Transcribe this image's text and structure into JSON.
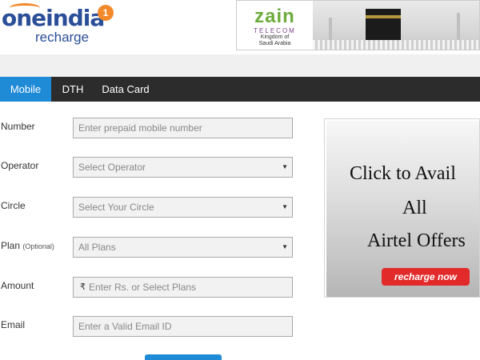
{
  "header": {
    "logo_main": "oneindia",
    "logo_sub": "recharge",
    "logo_badge": "1"
  },
  "banner": {
    "brand": "zain",
    "tagline": "TELECOM",
    "country_line1": "Kingdom of",
    "country_line2": "Saudi Arabia"
  },
  "tabs": [
    {
      "label": "Mobile",
      "active": true
    },
    {
      "label": "DTH",
      "active": false
    },
    {
      "label": "Data Card",
      "active": false
    }
  ],
  "form": {
    "number": {
      "label": "Number",
      "placeholder": "Enter prepaid mobile number"
    },
    "operator": {
      "label": "Operator",
      "value": "Select Operator"
    },
    "circle": {
      "label": "Circle",
      "value": "Select Your Circle"
    },
    "plan": {
      "label": "Plan",
      "optional": "(Optional)",
      "value": "All Plans"
    },
    "amount": {
      "label": "Amount",
      "currency": "₹",
      "placeholder": "Enter Rs. or Select Plans"
    },
    "email": {
      "label": "Email",
      "placeholder": "Enter a Valid Email ID"
    }
  },
  "promo": {
    "line1": "Click to Avail",
    "line2": "All",
    "line3": "Airtel Offers",
    "button": "recharge now"
  },
  "colors": {
    "accent": "#1f8ad6",
    "tab_bar": "#2c2c2c",
    "logo_blue": "#2a4e98",
    "logo_orange": "#f2892a",
    "promo_button": "#e32a2a"
  }
}
